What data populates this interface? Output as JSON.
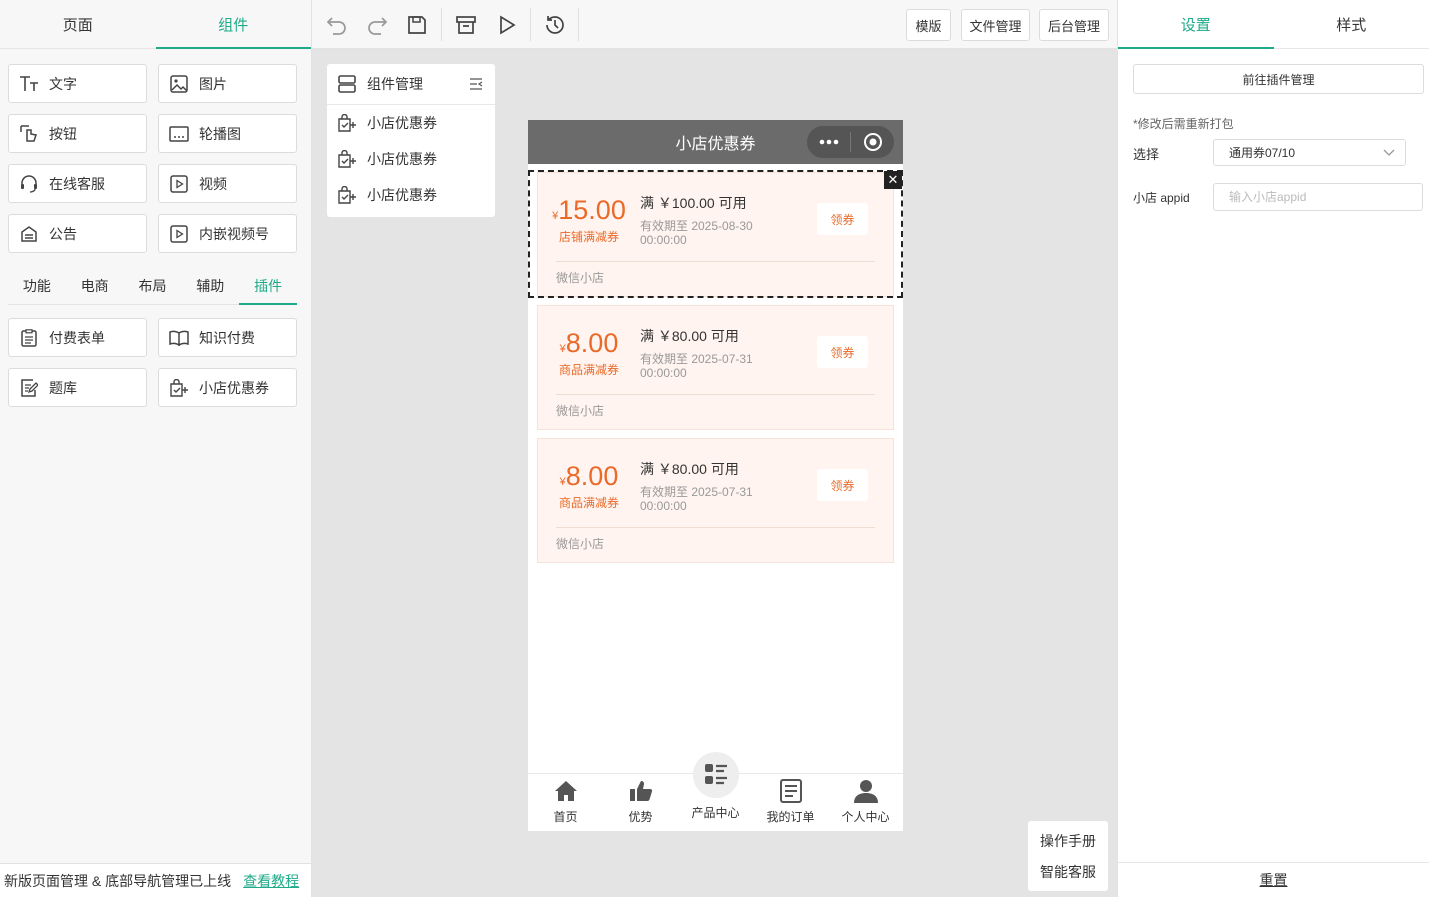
{
  "left": {
    "tabs": [
      "页面",
      "组件"
    ],
    "basic_components": [
      "文字",
      "图片",
      "按钮",
      "轮播图",
      "在线客服",
      "视频",
      "公告",
      "内嵌视频号"
    ],
    "sub_tabs": [
      "功能",
      "电商",
      "布局",
      "辅助",
      "插件"
    ],
    "plugin_components": [
      "付费表单",
      "知识付费",
      "题库",
      "小店优惠券"
    ],
    "notice_text": "新版页面管理 & 底部导航管理已上线",
    "notice_link": "查看教程"
  },
  "toolbar": {
    "template_label": "模版",
    "files_label": "文件管理",
    "admin_label": "后台管理"
  },
  "component_manager": {
    "title": "组件管理",
    "items": [
      "小店优惠券",
      "小店优惠券",
      "小店优惠券"
    ]
  },
  "phone": {
    "title": "小店优惠券",
    "close_symbol": "✕",
    "coupons": [
      {
        "currency": "¥",
        "amount": "15.00",
        "type": "店铺满减券",
        "condition": "满 ￥100.00 可用",
        "valid": "有效期至 2025-08-30 00:00:00",
        "button": "领券",
        "shop": "微信小店"
      },
      {
        "currency": "¥",
        "amount": "8.00",
        "type": "商品满减券",
        "condition": "满 ￥80.00 可用",
        "valid": "有效期至 2025-07-31 00:00:00",
        "button": "领券",
        "shop": "微信小店"
      },
      {
        "currency": "¥",
        "amount": "8.00",
        "type": "商品满减券",
        "condition": "满 ￥80.00 可用",
        "valid": "有效期至 2025-07-31 00:00:00",
        "button": "领券",
        "shop": "微信小店"
      }
    ],
    "nav": [
      "首页",
      "优势",
      "产品中心",
      "我的订单",
      "个人中心"
    ]
  },
  "help": {
    "manual": "操作手册",
    "service": "智能客服"
  },
  "right": {
    "tabs": [
      "设置",
      "样式"
    ],
    "plugin_button": "前往插件管理",
    "hint": "*修改后需重新打包",
    "select_label": "选择",
    "select_value": "通用券07/10",
    "appid_label": "小店 appid",
    "appid_placeholder": "输入小店appid",
    "reset": "重置"
  },
  "colors": {
    "accent": "#1fab89",
    "coupon_orange": "#ea6a2a",
    "coupon_bg": "#fff4ef",
    "phone_header": "#6b6b6b"
  }
}
